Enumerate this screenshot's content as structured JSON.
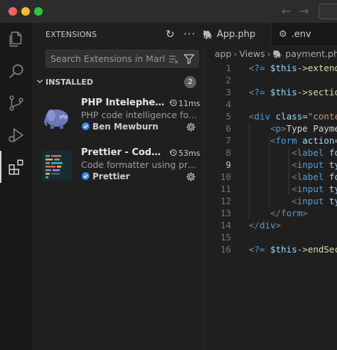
{
  "window": {
    "nav_back": "←",
    "nav_forward": "→"
  },
  "activity_bar": {
    "items": [
      "explorer-icon",
      "search-icon",
      "source-control-icon",
      "run-debug-icon",
      "extensions-icon"
    ],
    "active": "extensions-icon"
  },
  "sidebar": {
    "title": "EXTENSIONS",
    "refresh_icon": "↻",
    "more_icon": "···",
    "search": {
      "placeholder": "Search Extensions in Marketplace",
      "value": ""
    },
    "section": {
      "label": "INSTALLED",
      "count": "2"
    },
    "extensions": [
      {
        "name": "PHP Intelephense",
        "time": "11ms",
        "description": "PHP code intelligence for Visual Studio Code",
        "publisher": "Ben Mewburn",
        "icon": "php-elephant-icon"
      },
      {
        "name": "Prettier - Code formatter",
        "time": "53ms",
        "description": "Code formatter using prettier",
        "publisher": "Prettier",
        "icon": "prettier-icon"
      }
    ]
  },
  "editor": {
    "tabs": [
      {
        "label": "App.php",
        "icon": "elephant-icon",
        "active": true
      },
      {
        "label": ".env",
        "icon": "gear-icon",
        "active": false
      }
    ],
    "breadcrumbs": {
      "part1": "app",
      "part2": "Views",
      "part3": "payment.php"
    },
    "current_line": 9,
    "line_numbers": [
      "1",
      "2",
      "3",
      "4",
      "5",
      "6",
      "7",
      "8",
      "9",
      "10",
      "11",
      "12",
      "13",
      "14",
      "15",
      "16"
    ]
  },
  "colors": {
    "accent": "#3794ff",
    "verified": "#3794ff",
    "badge": "#616161"
  }
}
